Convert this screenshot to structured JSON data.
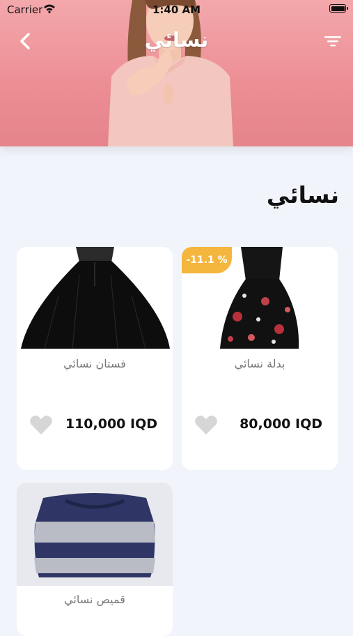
{
  "status_bar": {
    "carrier": "Carrier",
    "time": "1:40 AM"
  },
  "header": {
    "title": "نسائي"
  },
  "section": {
    "title": "نسائي"
  },
  "products": [
    {
      "name": "بدلة نسائي",
      "price": "80,000 IQD",
      "discount": "-11.1 %"
    },
    {
      "name": "فستان نسائي",
      "price": "110,000 IQD"
    },
    {
      "name": "قميص نسائي"
    }
  ],
  "colors": {
    "accent_badge": "#f5b63d",
    "header_pink": "#ec8d93",
    "background": "#f1f5fb",
    "heart": "#d6d6d6"
  },
  "icons": [
    "wifi-icon",
    "battery-icon",
    "back-chevron-icon",
    "filter-icon",
    "heart-icon"
  ]
}
